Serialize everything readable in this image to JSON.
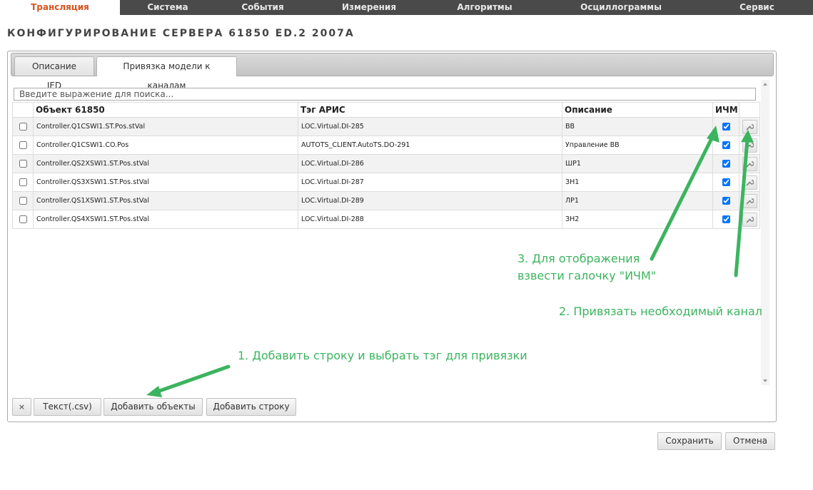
{
  "nav": {
    "items": [
      "Трансляция",
      "Система",
      "События",
      "Измерения",
      "Алгоритмы",
      "Осциллограммы",
      "Сервис"
    ],
    "active": "Трансляция"
  },
  "page": {
    "title": "КОНФИГУРИРОВАНИЕ СЕРВЕРА 61850 ED.2 2007A"
  },
  "tabs": [
    "Описание IED",
    "Привязка модели к каналам"
  ],
  "search": {
    "placeholder": "Введите выражение для поиска...",
    "value": ""
  },
  "table": {
    "columns": [
      "Объект 61850",
      "Тэг АРИС",
      "Описание",
      "ИЧМ"
    ],
    "rows": [
      {
        "object": "Controller.Q1CSWI1.ST.Pos.stVal",
        "tag": "LOC.Virtual.DI-285",
        "desc": "ВВ",
        "ichm": true
      },
      {
        "object": "Controller.Q1CSWI1.CO.Pos",
        "tag": "AUTOTS_CLIENT.AutoTS.DO-291",
        "desc": "Управление ВВ",
        "ichm": true
      },
      {
        "object": "Controller.QS2XSWI1.ST.Pos.stVal",
        "tag": "LOC.Virtual.DI-286",
        "desc": "ШР1",
        "ichm": true
      },
      {
        "object": "Controller.QS3XSWI1.ST.Pos.stVal",
        "tag": "LOC.Virtual.DI-287",
        "desc": "ЗН1",
        "ichm": true
      },
      {
        "object": "Controller.QS1XSWI1.ST.Pos.stVal",
        "tag": "LOC.Virtual.DI-289",
        "desc": "ЛР1",
        "ichm": true
      },
      {
        "object": "Controller.QS4XSWI1.ST.Pos.stVal",
        "tag": "LOC.Virtual.DI-288",
        "desc": "ЗН2",
        "ichm": true
      }
    ]
  },
  "buttons": {
    "clear": "×",
    "csv": "Текст(.csv)",
    "add_objects": "Добавить объекты",
    "add_row": "Добавить строку",
    "save": "Сохранить",
    "cancel": "Отмена"
  },
  "annotations": {
    "step1": "1. Добавить строку и выбрать тэг для привязки",
    "step2": "2. Привязать необходимый канал",
    "step3_line1": "3. Для отображения",
    "step3_line2": "взвести галочку \"ИЧМ\"",
    "color": "#3cb45f"
  },
  "colors": {
    "nav_bg": "#4a4a4a",
    "nav_active_text": "#d9531e"
  },
  "icons": {
    "row_action": "wrench-icon"
  }
}
